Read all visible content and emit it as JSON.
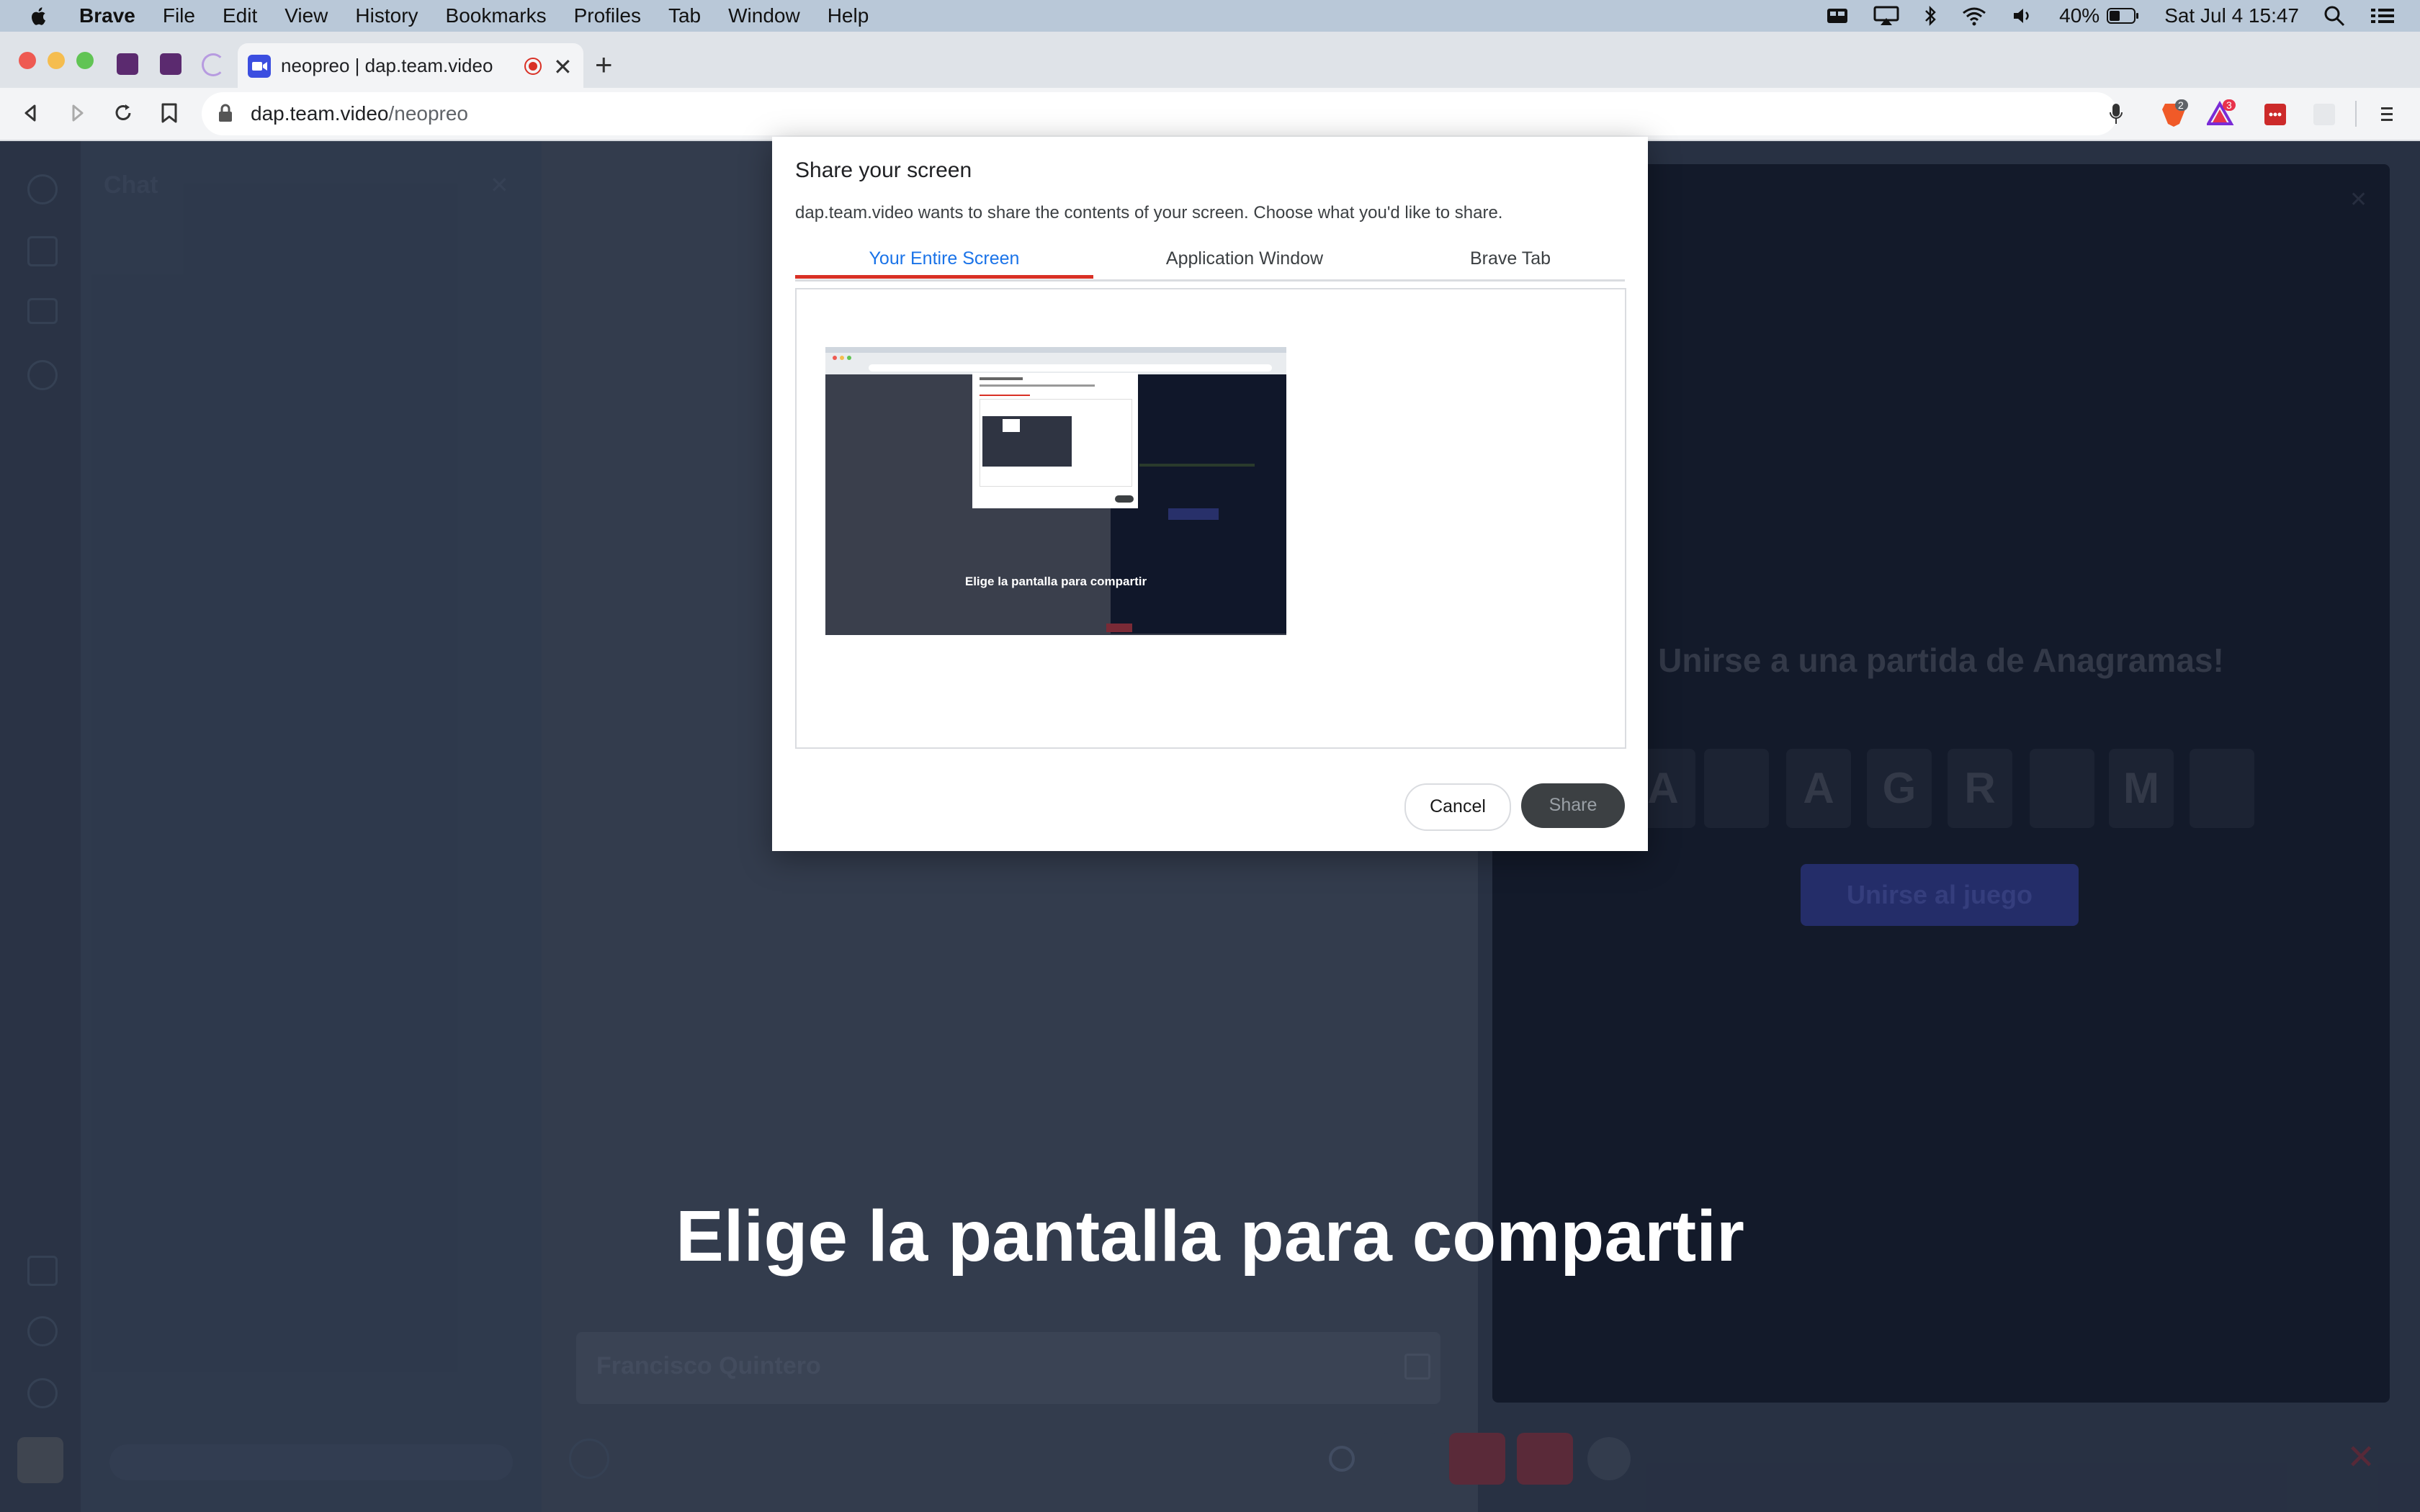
{
  "menubar": {
    "items": [
      "Brave",
      "File",
      "Edit",
      "View",
      "History",
      "Bookmarks",
      "Profiles",
      "Tab",
      "Window",
      "Help"
    ],
    "battery": "40%",
    "clock": "Sat Jul 4  15:47"
  },
  "browser": {
    "tab_title": "neopreo | dap.team.video",
    "url_host": "dap.team.video",
    "url_path": "/neopreo",
    "brave_shield_badge": "2",
    "rewards_badge": "3"
  },
  "app": {
    "chat_title": "Chat",
    "participant_name": "Francisco Quintero",
    "game_title": "Unirse a una partida de Anagramas!",
    "game_letters": [
      "A",
      "A",
      "G",
      "R",
      "M"
    ],
    "join_button": "Unirse al juego"
  },
  "caption": "Elige la pantalla para compartir",
  "dialog": {
    "title": "Share your screen",
    "description": "dap.team.video wants to share the contents of your screen. Choose what you'd like to share.",
    "tabs": [
      "Your Entire Screen",
      "Application Window",
      "Brave Tab"
    ],
    "active_tab": "Your Entire Screen",
    "thumbnail_caption": "Elige la pantalla para compartir",
    "cancel_label": "Cancel",
    "share_label": "Share"
  },
  "colors": {
    "accent": "#1a73e8",
    "tab_indicator": "#d93025",
    "record": "#d93025"
  },
  "icons": [
    "apple-icon",
    "mission-control-icon",
    "airplay-icon",
    "bluetooth-icon",
    "wifi-icon",
    "volume-icon",
    "battery-icon",
    "spotlight-icon",
    "control-center-icon",
    "back-icon",
    "forward-icon",
    "reload-icon",
    "bookmark-icon",
    "lock-icon",
    "mic-icon",
    "brave-shield-icon",
    "brave-rewards-icon",
    "extension-icon",
    "menu-icon"
  ]
}
